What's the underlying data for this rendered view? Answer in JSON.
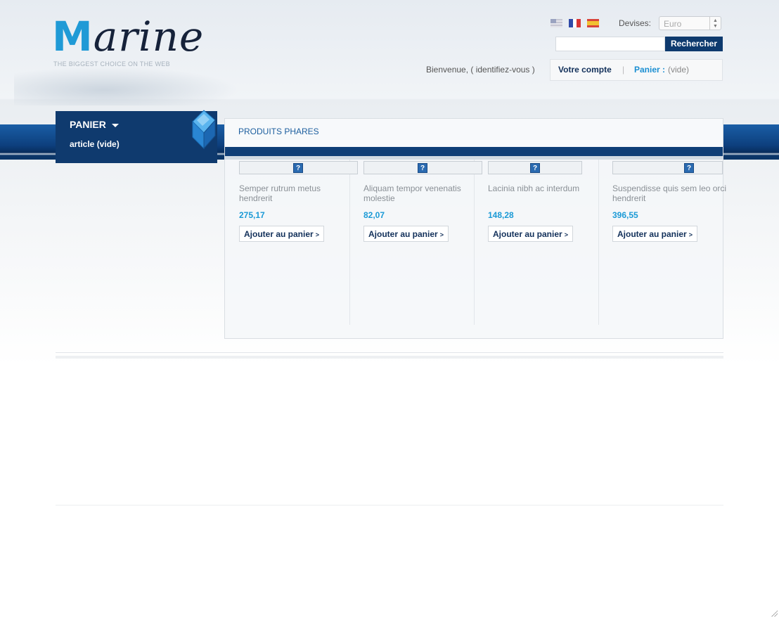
{
  "header": {
    "logo_first": "M",
    "logo_rest": "arine",
    "tagline": "THE BIGGEST CHOICE ON THE WEB",
    "languages": [
      "english-flag-icon",
      "french-flag-icon",
      "spanish-flag-icon"
    ],
    "currency_label": "Devises:",
    "currency_value": "Euro",
    "search_placeholder": "",
    "search_button": "Rechercher",
    "welcome_text": "Bienvenue, ( identifiez-vous )",
    "account_link": "Votre compte",
    "separator": "|",
    "cart_link": "Panier :",
    "cart_status": "(vide)"
  },
  "sidebar": {
    "cart_title": "PANIER",
    "cart_article": "article (vide)"
  },
  "featured": {
    "title": "PRODUITS PHARES",
    "products": [
      {
        "name": "Semper rutrum metus hendrerit",
        "price": "275,17",
        "button": "Ajouter au panier",
        "button_arrow": ">"
      },
      {
        "name": "Aliquam tempor venenatis molestie",
        "price": "82,07",
        "button": "Ajouter au panier",
        "button_arrow": ">"
      },
      {
        "name": "Lacinia nibh ac interdum",
        "price": "148,28",
        "button": "Ajouter au panier",
        "button_arrow": ">"
      },
      {
        "name": "Suspendisse quis sem leo orci hendrerit",
        "price": "396,55",
        "button": "Ajouter au panier",
        "button_arrow": ">"
      }
    ],
    "image_placeholder_glyph": "?"
  },
  "colors": {
    "brand_navy": "#0f3a6e",
    "accent_blue": "#1b9ad6"
  }
}
